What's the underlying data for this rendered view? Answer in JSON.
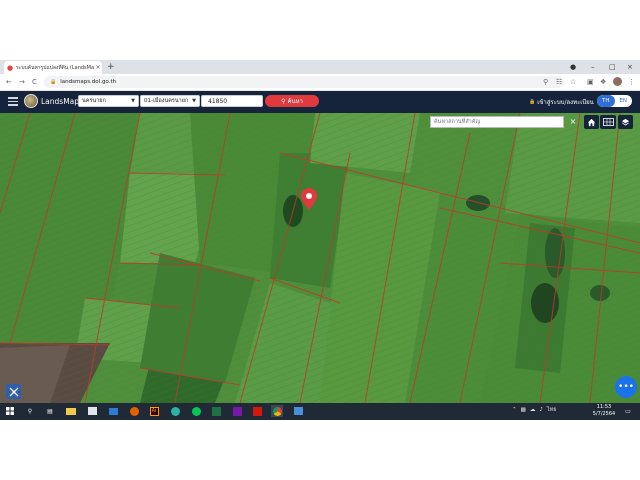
{
  "browser": {
    "tab_title": "ระบบค้นหารูปแปลงที่ดิน (LandsMaps",
    "tab_close": "×",
    "new_tab": "+",
    "win_minimize": "–",
    "win_maximize": "□",
    "win_close": "×",
    "url": "landsmaps.dol.go.th",
    "back": "←",
    "forward": "→",
    "reload": "C"
  },
  "app": {
    "brand": "LandsMaps",
    "province": "นครนายก",
    "district": "01-เมืองนครนายก",
    "parcel_no": "41850",
    "search_label": "ค้นหา",
    "login_label": "เข้าสู่ระบบ/ลงทะเบียน",
    "lang_th": "TH",
    "lang_en": "EN"
  },
  "map": {
    "search_placeholder": "ค้นหาสถานที่สำคัญ",
    "clear": "×",
    "fab_label": "•••",
    "marker_color": "#e0393e"
  },
  "taskbar": {
    "time": "11:53",
    "date": "5/7/2564",
    "lang": "ไทย"
  },
  "colors": {
    "header_bg": "#15243b",
    "accent_red": "#e0393e",
    "accent_blue": "#2f6fd6"
  }
}
